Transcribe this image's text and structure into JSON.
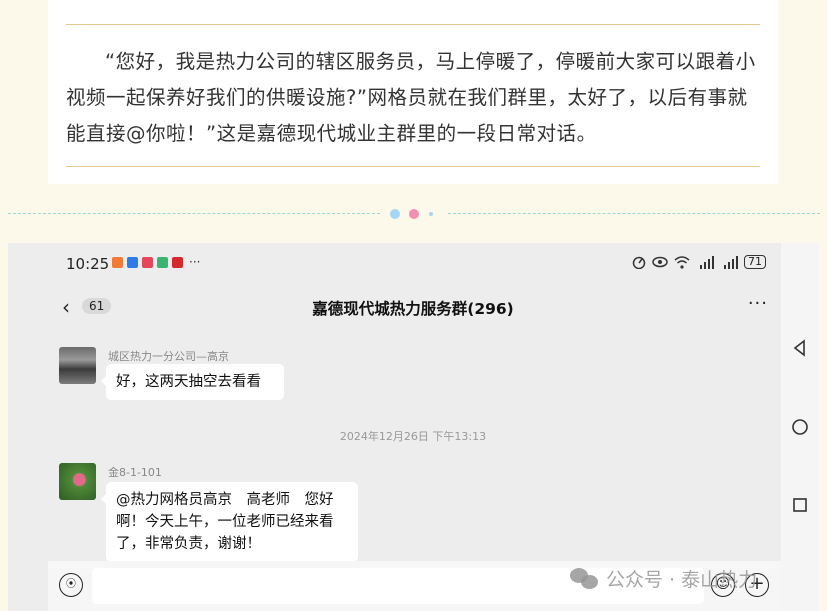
{
  "article": {
    "quote": "“您好，我是热力公司的辖区服务员，马上停暖了，停暖前大家可以跟着小视频一起保养好我们的供暖设施?”网格员就在我们群里，太好了，以后有事就能直接@你啦！”这是嘉德现代城业主群里的一段日常对话。"
  },
  "phone": {
    "status": {
      "time": "10:25",
      "more": "···",
      "battery": "71"
    },
    "header": {
      "back_count": "61",
      "title": "嘉德现代城热力服务群(296)",
      "menu": "···"
    },
    "messages": [
      {
        "sender": "城区热力一分公司—高京",
        "text": "好，这两天抽空去看看"
      },
      {
        "sender": "金8-1-101",
        "text": "@热力网格员高京　高老师　您好啊！今天上午，一位老师已经来看了，非常负责，谢谢！"
      }
    ],
    "timestamp": "2024年12月26日 下午13:13"
  },
  "watermark": {
    "text": "公众号 · 泰山热力"
  },
  "colors": {
    "accent_gold": "#e4c98f",
    "page_bg": "#fdf9ea",
    "chat_bg": "#ededed"
  },
  "icons": [
    "back-chevron-icon",
    "more-dots-icon",
    "voice-icon",
    "emoji-icon",
    "plus-icon",
    "nav-back-icon",
    "nav-home-icon",
    "nav-recent-icon",
    "wechat-icon"
  ]
}
